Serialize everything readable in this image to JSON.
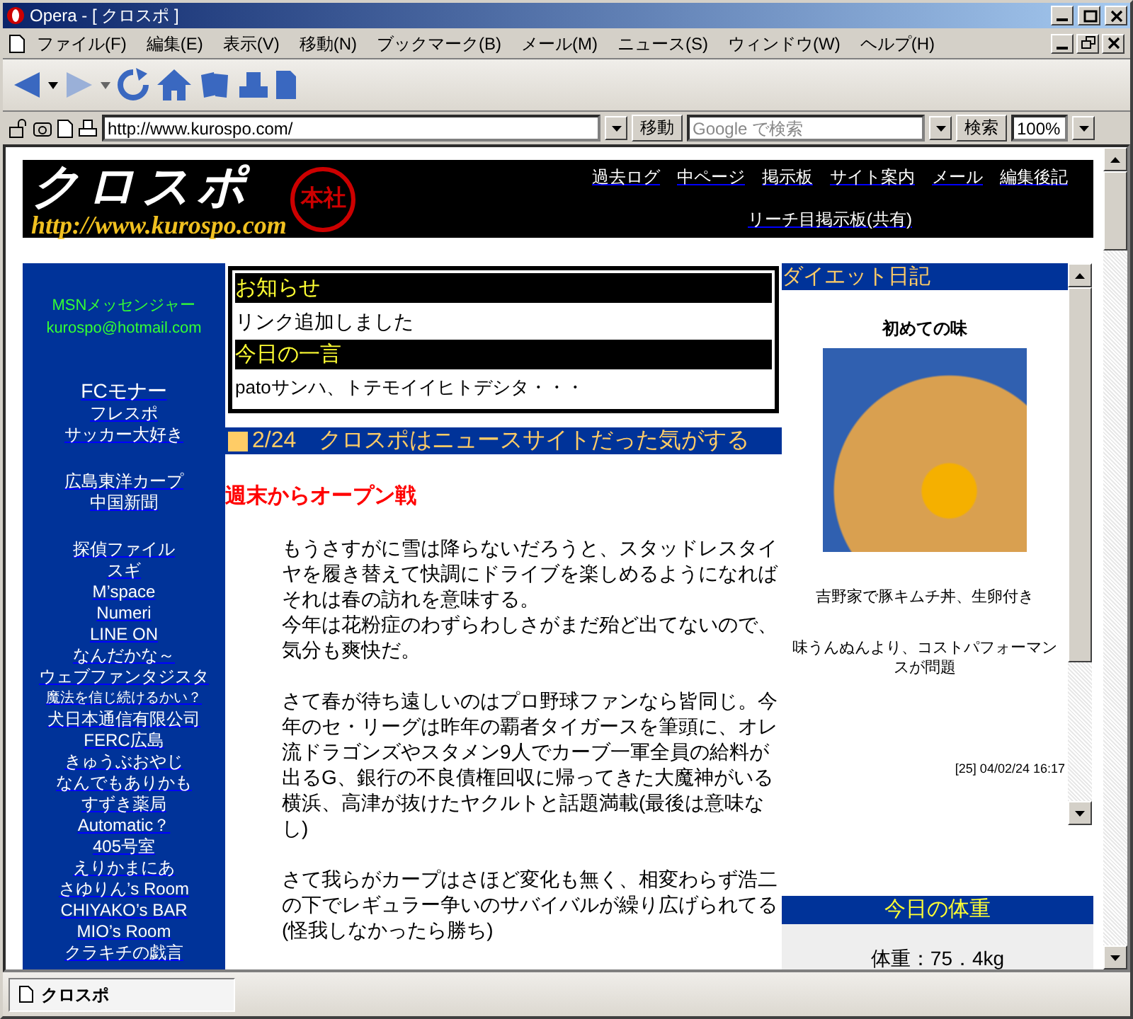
{
  "window": {
    "title": "Opera - [ クロスポ ]"
  },
  "menu": [
    "ファイル(F)",
    "編集(E)",
    "表示(V)",
    "移動(N)",
    "ブックマーク(B)",
    "メール(M)",
    "ニュース(S)",
    "ウィンドウ(W)",
    "ヘルプ(H)"
  ],
  "address_bar": {
    "url": "http://www.kurospo.com/",
    "go_button": "移動",
    "search_placeholder": "Google で検索",
    "search_button": "検索",
    "zoom": "100%"
  },
  "page": {
    "header": {
      "logo_text": "クロスポ",
      "logo_url": "http://www.kurospo.com",
      "stamp_text": "本社",
      "nav": [
        "過去ログ",
        "中ページ",
        "掲示板",
        "サイト案内",
        "メール",
        "編集後記"
      ],
      "nav_second": [
        "リーチ目掲示板(共有)"
      ]
    },
    "sidebar": {
      "contact": [
        "MSNメッセンジャー",
        "kurospo@hotmail.com"
      ],
      "link_groups": [
        [
          {
            "text": "FCモナー",
            "kind": "large"
          },
          {
            "text": "フレスポ",
            "kind": "normal"
          },
          {
            "text": "サッカー大好き",
            "kind": "normal"
          }
        ],
        [
          {
            "text": "広島東洋カープ",
            "kind": "normal"
          },
          {
            "text": "中国新聞",
            "kind": "normal"
          }
        ],
        [
          {
            "text": "探偵ファイル",
            "kind": "normal"
          },
          {
            "text": "スギ",
            "kind": "normal"
          },
          {
            "text": "M’space",
            "kind": "normal"
          },
          {
            "text": "Numeri",
            "kind": "normal"
          },
          {
            "text": "LINE ON",
            "kind": "normal"
          },
          {
            "text": "なんだかな～",
            "kind": "normal"
          },
          {
            "text": "ウェブファンタジスタ",
            "kind": "normal"
          },
          {
            "text": "魔法を信じ続けるかい？",
            "kind": "small"
          },
          {
            "text": "犬日本通信有限公司",
            "kind": "normal"
          },
          {
            "text": "FERC広島",
            "kind": "normal"
          },
          {
            "text": "きゅうぶおやじ",
            "kind": "normal"
          },
          {
            "text": "なんでもありかも",
            "kind": "normal"
          },
          {
            "text": "すずき薬局",
            "kind": "normal"
          },
          {
            "text": "Automatic？",
            "kind": "normal"
          },
          {
            "text": "405号室",
            "kind": "normal"
          },
          {
            "text": "えりかまにあ",
            "kind": "normal"
          },
          {
            "text": "さゆりん’s Room",
            "kind": "normal"
          },
          {
            "text": "CHIYAKO’s BAR",
            "kind": "normal"
          },
          {
            "text": "MIO’s Room",
            "kind": "normal"
          },
          {
            "text": "クラキチの戯言",
            "kind": "normal"
          }
        ]
      ]
    },
    "notices": [
      {
        "heading": "お知らせ",
        "text": "リンク追加しました"
      },
      {
        "heading": "今日の一言",
        "text": "patoサンハ、トテモイイヒトデシタ・・・"
      }
    ],
    "article": {
      "date": "2/24",
      "title": "クロスポはニュースサイトだった気がする",
      "subtitle": "週末からオープン戦",
      "paragraphs": [
        [
          "もうさすがに雪は降らないだろうと、スタッドレスタイヤを履き替えて快調にドライブを楽しめるようになればそれは春の訪れを意味する。",
          "今年は花粉症のわずらわしさがまだ殆ど出てないので、気分も爽快だ。"
        ],
        [
          "さて春が待ち遠しいのはプロ野球ファンなら皆同じ。今年のセ・リーグは昨年の覇者タイガースを筆頭に、オレ流ドラゴンズやスタメン9人でカーブ一軍全員の給料が出るG、銀行の不良債権回収に帰ってきた大魔神がいる横浜、高津が抜けたヤクルトと話題満載(最後は意味なし)"
        ],
        [
          "さて我らがカープはさほど変化も無く、相変わらず浩二の下でレギュラー争いのサバイバルが繰り広げられてる(怪我しなかったら勝ち)"
        ]
      ]
    },
    "diet": {
      "heading": "ダイエット日記",
      "entry_title": "初めての味",
      "caption": "吉野家で豚キムチ丼、生卵付き",
      "comment": "味うんぬんより、コストパフォーマンスが問題",
      "stamp": "[25] 04/02/24 16:17"
    },
    "weight": {
      "heading": "今日の体重",
      "value": "体重：75．4kg"
    }
  },
  "tabs": [
    {
      "label": "クロスポ",
      "selected": true
    }
  ]
}
